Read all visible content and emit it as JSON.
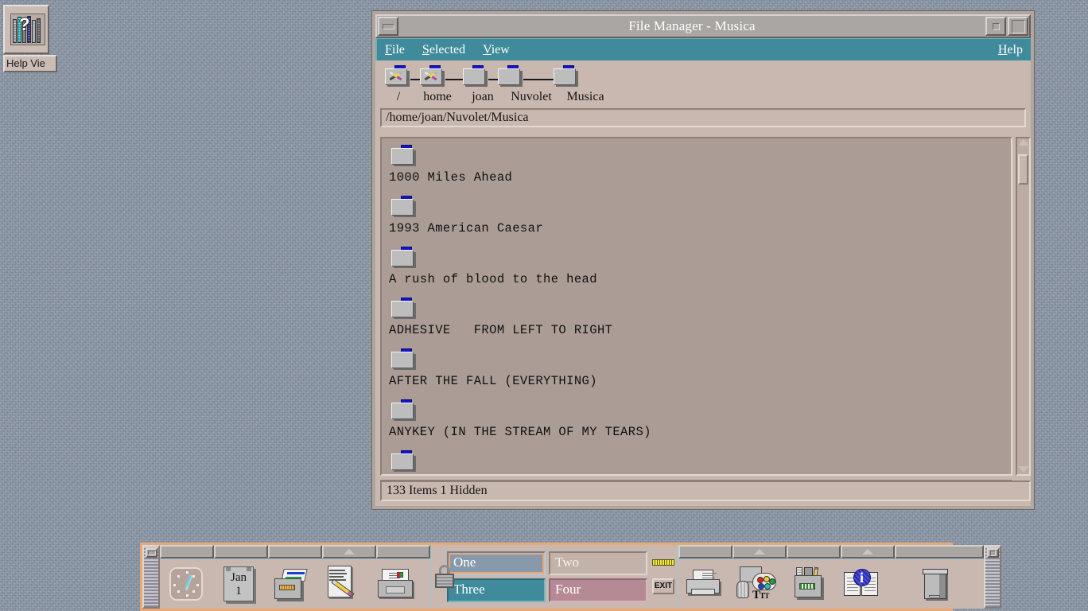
{
  "desktop": {
    "icons": [
      {
        "name": "help-viewer",
        "label": "Help Vie",
        "icon": "bookshelf-question-icon"
      }
    ]
  },
  "window": {
    "title": "File Manager - Musica",
    "controls": {
      "window_menu": "window-menu-icon",
      "minimize": "minimize-icon",
      "maximize": "maximize-icon"
    },
    "menubar": {
      "items": [
        {
          "label": "File",
          "mnemonic": "F"
        },
        {
          "label": "Selected",
          "mnemonic": "S"
        },
        {
          "label": "View",
          "mnemonic": "V"
        }
      ],
      "help": {
        "label": "Help",
        "mnemonic": "H"
      }
    },
    "breadcrumb": [
      {
        "label": "/",
        "icon": "folder-tools-icon",
        "restricted": true
      },
      {
        "label": "home",
        "icon": "folder-tools-icon",
        "restricted": true
      },
      {
        "label": "joan",
        "icon": "folder-icon",
        "restricted": false
      },
      {
        "label": "Nuvolet",
        "icon": "folder-icon",
        "restricted": false
      },
      {
        "label": "Musica",
        "icon": "folder-icon",
        "restricted": false
      }
    ],
    "path_field": {
      "value": "/home/joan/Nuvolet/Musica"
    },
    "files": [
      {
        "name": "1000 Miles Ahead",
        "icon": "folder-icon"
      },
      {
        "name": "1993 American Caesar",
        "icon": "folder-icon"
      },
      {
        "name": "A rush of blood to the head",
        "icon": "folder-icon"
      },
      {
        "name": "ADHESIVE   FROM LEFT TO RIGHT",
        "icon": "folder-icon"
      },
      {
        "name": "AFTER THE FALL (EVERYTHING)",
        "icon": "folder-icon"
      },
      {
        "name": "ANYKEY (IN THE STREAM OF MY TEARS)",
        "icon": "folder-icon"
      }
    ],
    "statusbar": {
      "text": "133 Items 1 Hidden"
    },
    "scrollbars": {
      "vertical": "scrollbar-vertical",
      "horizontal": "scrollbar-horizontal"
    }
  },
  "front_panel": {
    "left_handle": "panel-drag-handle-left",
    "right_handle": "panel-drag-handle-right",
    "launchers": [
      {
        "name": "clock",
        "icon": "clock-icon"
      },
      {
        "name": "calendar",
        "icon": "calendar-icon",
        "month": "Jan",
        "day": "1"
      },
      {
        "name": "file-manager",
        "icon": "file-drawer-icon"
      },
      {
        "name": "text-editor",
        "icon": "text-editor-pencil-icon"
      },
      {
        "name": "mailer",
        "icon": "mail-tray-icon"
      },
      {
        "name": "printer",
        "icon": "printer-icon"
      },
      {
        "name": "style-manager",
        "icon": "style-palette-icon"
      },
      {
        "name": "application-manager",
        "icon": "application-drawer-icon"
      },
      {
        "name": "help-manager",
        "icon": "help-book-icon"
      },
      {
        "name": "trash",
        "icon": "trash-can-icon"
      }
    ],
    "workspace_switch": {
      "lock_icon": "lock-icon",
      "busy_indicator": "busy-light-icon",
      "exit_label": "EXIT",
      "workspaces": [
        {
          "label": "One",
          "active": true,
          "color": "#8799ab"
        },
        {
          "label": "Two",
          "active": false,
          "color": "#c2b2a9"
        },
        {
          "label": "Three",
          "active": false,
          "color": "#3f8a9b"
        },
        {
          "label": "Four",
          "active": false,
          "color": "#b58a95"
        }
      ]
    }
  },
  "colors": {
    "desktop_bg": "#8b98a8",
    "window_bg": "#c9b8b0",
    "menubar_bg": "#3f8a9b",
    "titlebar_bg": "#a9a6a3",
    "list_bg": "#ab9d96",
    "panel_border": "#e8a878"
  }
}
